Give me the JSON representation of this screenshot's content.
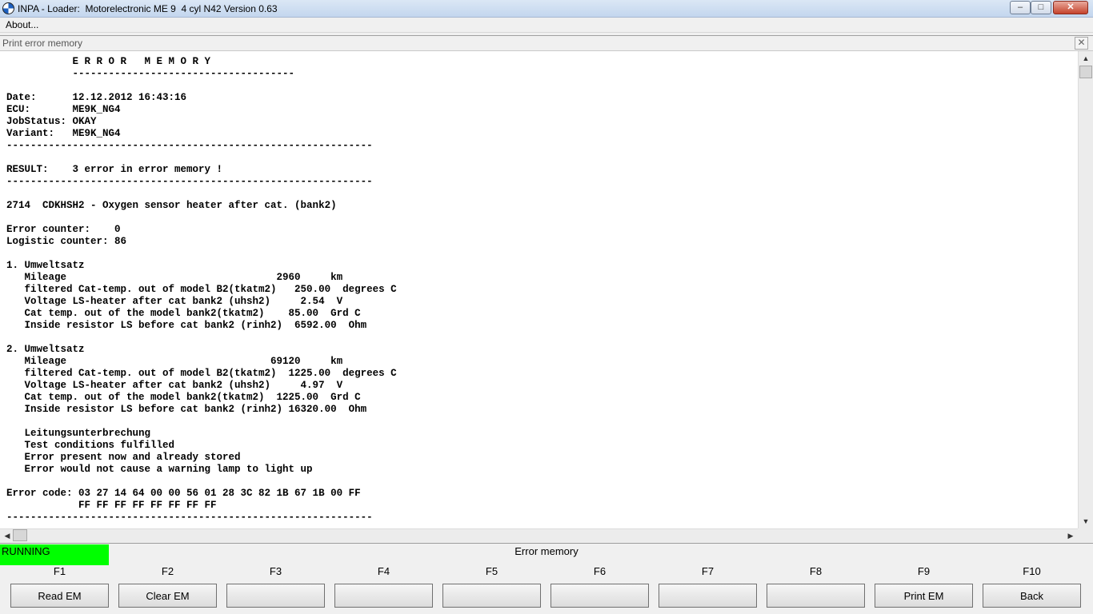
{
  "window": {
    "title": "INPA - Loader:  Motorelectronic ME 9  4 cyl N42 Version 0.63",
    "minimize_glyph": "–",
    "maximize_glyph": "□",
    "close_glyph": "✕"
  },
  "menu": {
    "about": "About..."
  },
  "child": {
    "title": "Print error memory",
    "close_glyph": "✕"
  },
  "report": {
    "lines": [
      "           E R R O R   M E M O R Y",
      "           -------------------------------------",
      "",
      "Date:      12.12.2012 16:43:16",
      "ECU:       ME9K_NG4",
      "JobStatus: OKAY",
      "Variant:   ME9K_NG4",
      "-------------------------------------------------------------",
      "",
      "RESULT:    3 error in error memory !",
      "-------------------------------------------------------------",
      "",
      "2714  CDKHSH2 - Oxygen sensor heater after cat. (bank2)",
      "",
      "Error counter:    0",
      "Logistic counter: 86",
      "",
      "1. Umweltsatz",
      "   Mileage                                   2960     km",
      "   filtered Cat-temp. out of model B2(tkatm2)   250.00  degrees C",
      "   Voltage LS-heater after cat bank2 (uhsh2)     2.54  V",
      "   Cat temp. out of the model bank2(tkatm2)    85.00  Grd C",
      "   Inside resistor LS before cat bank2 (rinh2)  6592.00  Ohm",
      "",
      "2. Umweltsatz",
      "   Mileage                                  69120     km",
      "   filtered Cat-temp. out of model B2(tkatm2)  1225.00  degrees C",
      "   Voltage LS-heater after cat bank2 (uhsh2)     4.97  V",
      "   Cat temp. out of the model bank2(tkatm2)  1225.00  Grd C",
      "   Inside resistor LS before cat bank2 (rinh2) 16320.00  Ohm",
      "",
      "   Leitungsunterbrechung",
      "   Test conditions fulfilled",
      "   Error present now and already stored",
      "   Error would not cause a warning lamp to light up",
      "",
      "Error code: 03 27 14 64 00 00 56 01 28 3C 82 1B 67 1B 00 FF",
      "            FF FF FF FF FF FF FF FF",
      "-------------------------------------------------------------"
    ]
  },
  "scroll": {
    "up": "▲",
    "down": "▼",
    "left": "◀",
    "right": "▶"
  },
  "status": {
    "state": "RUNNING",
    "screen": "Error memory"
  },
  "fkeys": [
    {
      "key": "F1",
      "label": "Read EM"
    },
    {
      "key": "F2",
      "label": "Clear EM"
    },
    {
      "key": "F3",
      "label": ""
    },
    {
      "key": "F4",
      "label": ""
    },
    {
      "key": "F5",
      "label": ""
    },
    {
      "key": "F6",
      "label": ""
    },
    {
      "key": "F7",
      "label": ""
    },
    {
      "key": "F8",
      "label": ""
    },
    {
      "key": "F9",
      "label": "Print EM"
    },
    {
      "key": "F10",
      "label": "Back"
    }
  ],
  "colors": {
    "running": "#00ff00",
    "background": "#f0f0f0"
  }
}
